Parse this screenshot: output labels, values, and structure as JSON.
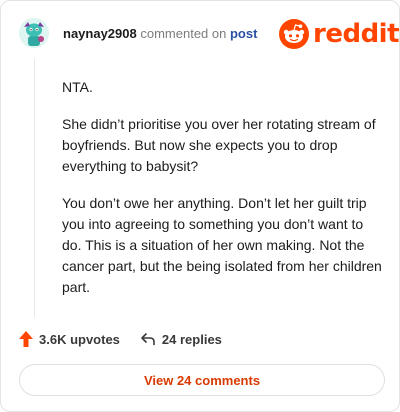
{
  "header": {
    "username": "naynay2908",
    "action_text": "commented on",
    "post_link": "post"
  },
  "brand": {
    "wordmark": "reddit",
    "icon": "reddit-alien-icon",
    "color": "#ff4500"
  },
  "comment": {
    "paragraphs": [
      "NTA.",
      "She didn’t prioritise you over her rotating stream of boyfriends. But now she expects you to drop everything to babysit?",
      "You don’t owe her anything. Don’t let her guilt trip you into agreeing to something you don’t want to do. This is a situation of her own making. Not the cancer part, but the being isolated from her children part."
    ]
  },
  "actions": {
    "upvotes": "3.6K upvotes",
    "upvote_icon": "upvote-arrow-icon",
    "upvote_color": "#ff4500",
    "replies": "24 replies",
    "reply_icon": "reply-arrow-icon"
  },
  "footer": {
    "view_comments": "View 24 comments",
    "accent": "#d93a00"
  }
}
